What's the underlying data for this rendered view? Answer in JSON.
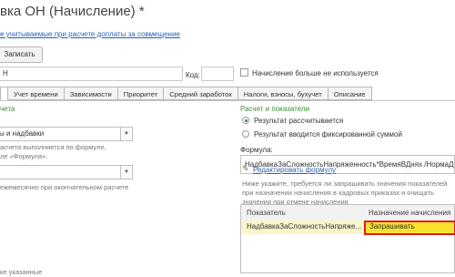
{
  "window": {
    "title": "вка ОН (Начисление) *"
  },
  "top_link": "е учитываемые при расчете доплаты за совмещение",
  "toolbar": {
    "save_label": "Записать"
  },
  "name_field": {
    "value": "Н"
  },
  "code": {
    "label": "Код:",
    "value": ""
  },
  "not_used_checkbox": {
    "label": "Начисление больше не используется",
    "checked": false
  },
  "tabs": [
    "",
    "Учет времени",
    "Зависимости",
    "Приоритет",
    "Средний заработок",
    "Налоги, взносы, бухучет",
    "Описание"
  ],
  "left": {
    "section_title": "чета",
    "combo1": {
      "value": "ы и надбавки"
    },
    "note1": [
      "асчета выполняется по формуле,",
      "ле «Формула»."
    ],
    "combo2": {
      "value": ""
    },
    "note2": "ежемесячно при окончательном расчете",
    "note3": "ке указанные"
  },
  "right": {
    "section_title": "Расчет и показатели",
    "radio_calc": {
      "label": "Результат рассчитывается",
      "selected": true
    },
    "radio_fixed": {
      "label": "Результат вводится фиксированной суммой",
      "selected": false
    },
    "formula_label": "Формула:",
    "formula_value": "НадбавкаЗаСложностьНапряженность*ВремяВДнях /НормаДне",
    "edit_formula_link": "Редактировать формулу",
    "hint": [
      "Ниже укажите, требуется ли запрашивать значения показателей",
      "при назначении начисления в кадровых приказах и очищать",
      "значения при отмене начисления"
    ],
    "table": {
      "headers": [
        "Показатель",
        "Назначение начисления"
      ],
      "rows": [
        [
          "НадбавкаЗаСложностьНапряже...",
          "Запрашивать"
        ]
      ]
    }
  }
}
